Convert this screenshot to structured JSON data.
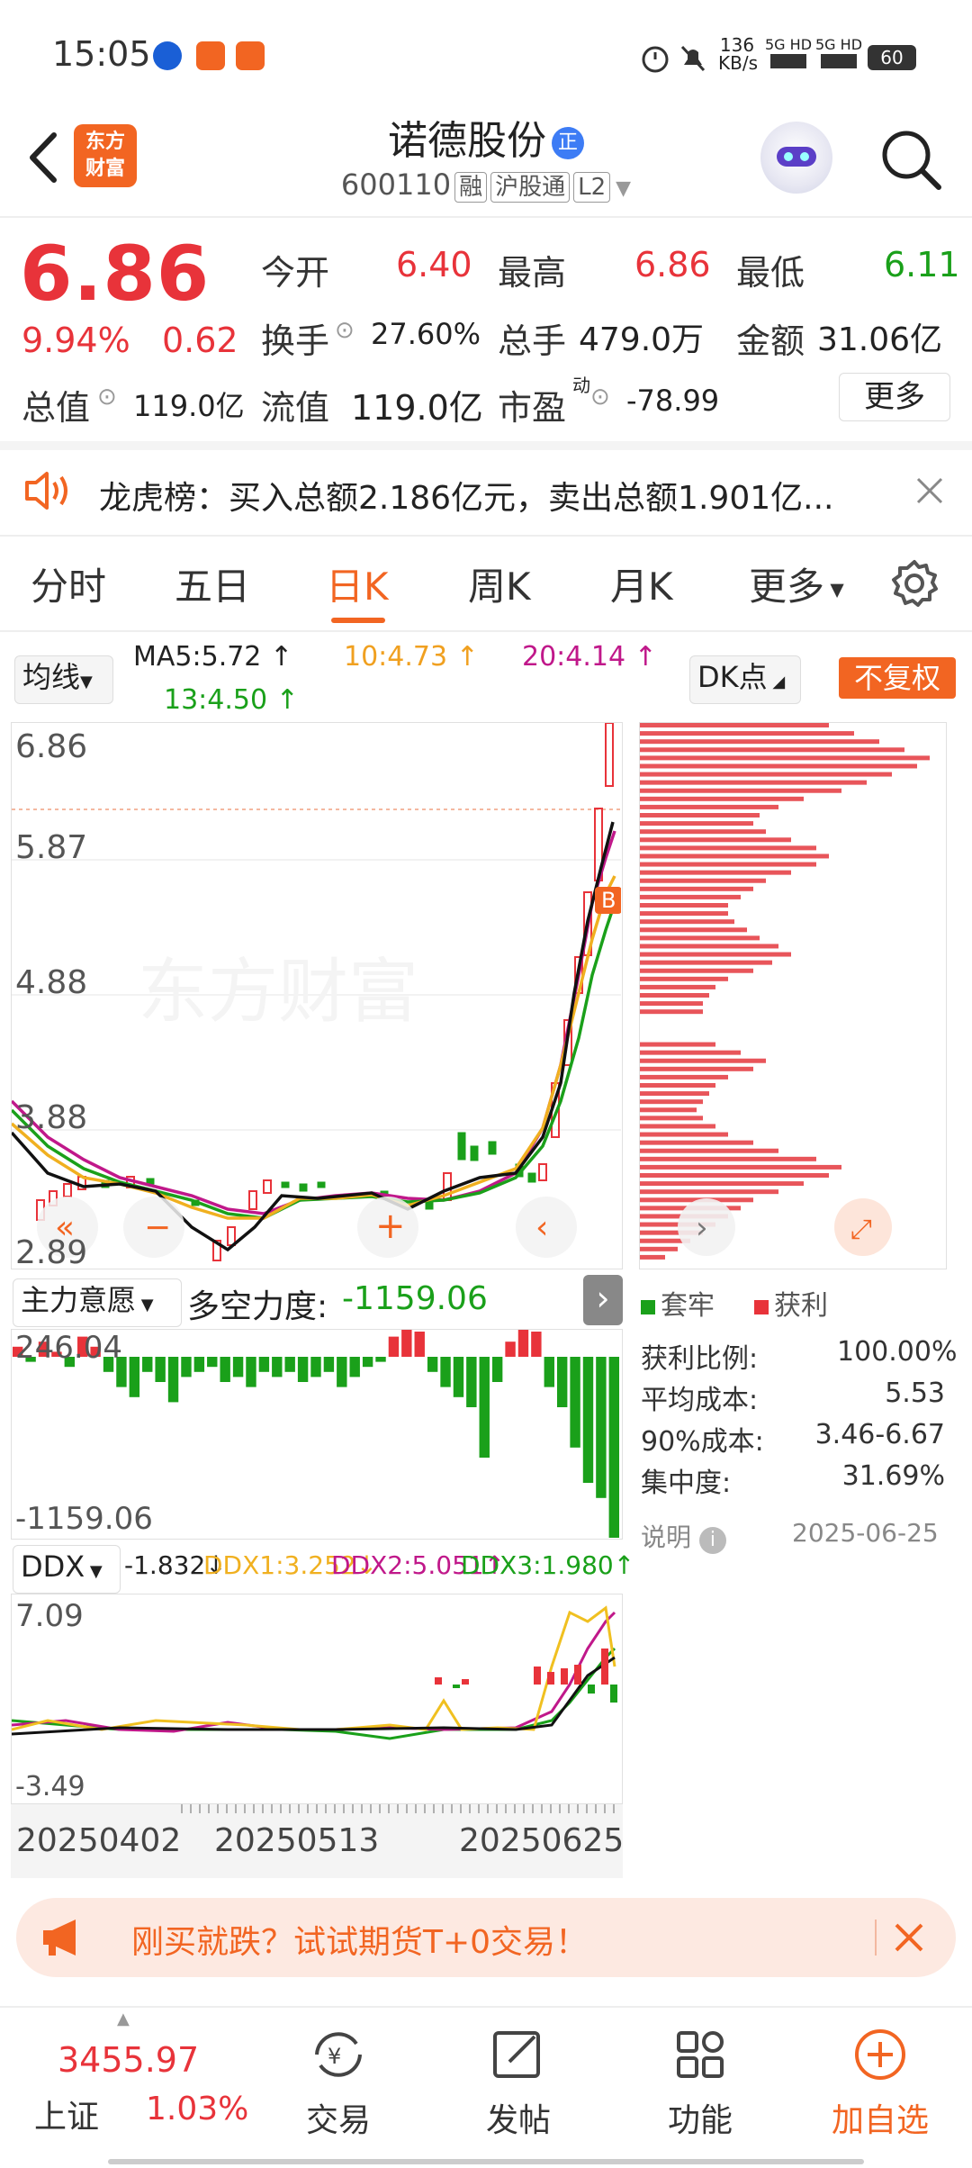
{
  "status_bar": {
    "time": "15:05",
    "net_speed": "136",
    "net_unit": "KB/s",
    "sig1": "5G HD",
    "sig2": "5G HD",
    "battery": "60"
  },
  "header": {
    "logo_text_1": "东方",
    "logo_text_2": "财富",
    "stock_name": "诺德股份",
    "badge": "正",
    "code": "600110",
    "tags": [
      "融",
      "沪股通",
      "L2"
    ]
  },
  "quote": {
    "price": "6.86",
    "change_pct": "9.94%",
    "change_amt": "0.62",
    "open_label": "今开",
    "open": "6.40",
    "high_label": "最高",
    "high": "6.86",
    "low_label": "最低",
    "low": "6.11",
    "turnover_label": "换手",
    "turnover": "27.60%",
    "volume_label": "总手",
    "volume": "479.0万",
    "amount_label": "金额",
    "amount": "31.06亿",
    "mktcap_label": "总值",
    "mktcap": "119.0亿",
    "float_label": "流值",
    "float": "119.0亿",
    "pe_label": "市盈",
    "pe_sup": "动",
    "pe": "-78.99",
    "more": "更多"
  },
  "notice": {
    "text": "龙虎榜：买入总额2.186亿元，卖出总额1.901亿..."
  },
  "tabs": [
    "分时",
    "五日",
    "日K",
    "周K",
    "月K",
    "更多"
  ],
  "kline": {
    "ma_select": "均线",
    "ma5": "MA5:5.72",
    "ma10": "10:4.73",
    "ma20": "20:4.14",
    "ma13": "13:4.50",
    "dk_label": "DK点",
    "fq_label": "不复权",
    "y_labels": [
      "6.86",
      "5.87",
      "4.88",
      "3.88",
      "2.89"
    ],
    "watermark": "东方财富",
    "b_marker": "B"
  },
  "chip": {
    "legend_trapped": "套牢",
    "legend_profit": "获利",
    "profit_ratio_label": "获利比例:",
    "profit_ratio": "100.00%",
    "avg_cost_label": "平均成本:",
    "avg_cost": "5.53",
    "cost90_label": "90%成本:",
    "cost90": "3.46-6.67",
    "concentration_label": "集中度:",
    "concentration": "31.69%",
    "explain": "说明",
    "date": "2025-06-25"
  },
  "main_force": {
    "select": "主力意愿",
    "label": "多空力度:",
    "value": "-1159.06",
    "top": "246.04",
    "bottom": "-1159.06"
  },
  "ddx": {
    "select": "DDX",
    "ddx": "-1.832",
    "ddx1": "DDX1:3.252",
    "ddx2": "DDX2:5.051",
    "ddx3": "DDX3:1.980",
    "top": "7.09",
    "bottom": "-3.49"
  },
  "x_dates": [
    "20250402",
    "20250513",
    "20250625"
  ],
  "banner": {
    "text": "刚买就跌？试试期货T+0交易！"
  },
  "bottom_nav": {
    "index_value": "3455.97",
    "index_name": "上证",
    "index_pct": "1.03%",
    "items": [
      "交易",
      "发帖",
      "功能",
      "加自选"
    ]
  },
  "colors": {
    "up": "#e8333a",
    "down": "#1aa01a",
    "accent": "#f26522"
  }
}
